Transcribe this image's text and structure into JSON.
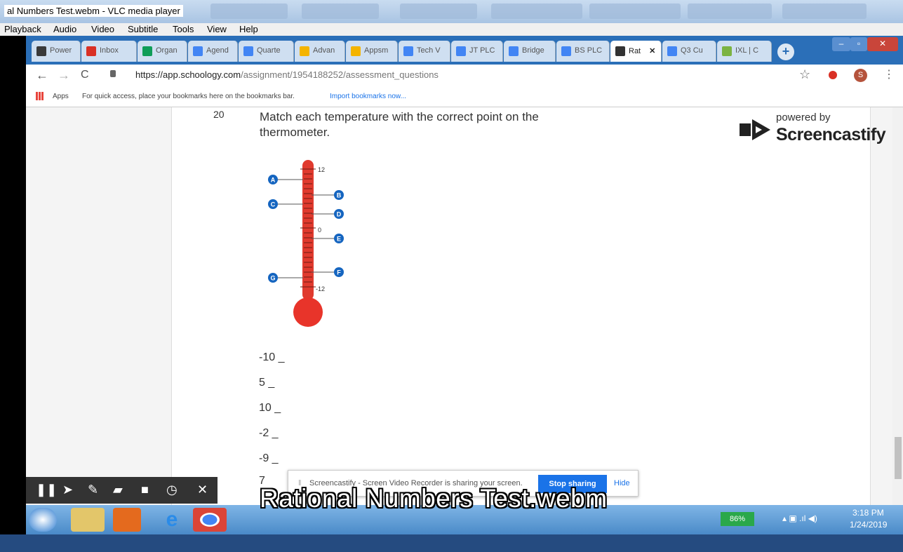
{
  "vlc": {
    "title": "al Numbers Test.webm - VLC media player",
    "menu": [
      "Playback",
      "Audio",
      "Video",
      "Subtitle",
      "Tools",
      "View",
      "Help"
    ]
  },
  "tabs": [
    {
      "label": "Power",
      "color": "#3a3a3a"
    },
    {
      "label": "Inbox",
      "color": "#d93025"
    },
    {
      "label": "Organ",
      "color": "#0f9d58"
    },
    {
      "label": "Agend",
      "color": "#4285f4"
    },
    {
      "label": "Quarte",
      "color": "#4285f4"
    },
    {
      "label": "Advan",
      "color": "#f4b400"
    },
    {
      "label": "Appsm",
      "color": "#f4b400"
    },
    {
      "label": "Tech V",
      "color": "#4285f4"
    },
    {
      "label": "JT PLC",
      "color": "#4285f4"
    },
    {
      "label": "Bridge",
      "color": "#4285f4"
    },
    {
      "label": "BS PLC",
      "color": "#4285f4"
    },
    {
      "label": "Rat",
      "color": "#333333"
    },
    {
      "label": "Q3 Cu",
      "color": "#4285f4"
    },
    {
      "label": "IXL | C",
      "color": "#7cb342"
    }
  ],
  "address": {
    "url_host": "https://app.schoology.com",
    "url_path": "/assignment/1954188252/assessment_questions",
    "profile_initial": "S"
  },
  "bookmarks": {
    "apps_label": "Apps",
    "hint": "For quick access, place your bookmarks here on the bookmarks bar.",
    "import_link": "Import bookmarks now..."
  },
  "question": {
    "number": "20",
    "text": "Match each temperature with the correct point on the thermometer.",
    "thermo_labels": {
      "top": "12",
      "zero": "0",
      "bottom": "-12"
    },
    "points": [
      "A",
      "B",
      "C",
      "D",
      "E",
      "F",
      "G"
    ],
    "answers": [
      "-10 _",
      "5 _",
      "10 _",
      "-2 _",
      "-9 _",
      "7"
    ]
  },
  "screencastify": {
    "powered": "powered by",
    "name": "Screencastify",
    "share_text": "Screencastify - Screen Video Recorder is sharing your screen.",
    "stop": "Stop sharing",
    "hide": "Hide"
  },
  "taskbar": {
    "battery": "86%",
    "time": "3:18 PM",
    "date": "1/24/2019"
  },
  "subtitle": "Rational Numbers Test.webm"
}
